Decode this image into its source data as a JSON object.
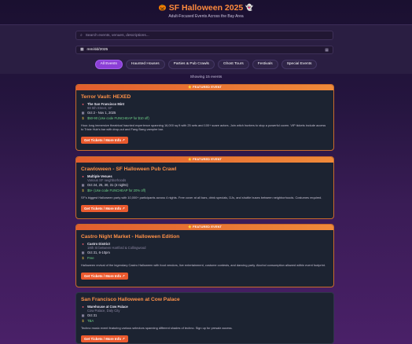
{
  "header": {
    "title": "SF Halloween 2025",
    "title_emoji_left": "🎃",
    "title_emoji_right": "👻",
    "subtitle": "Adult-Focused Events Across the Bay Area"
  },
  "search": {
    "placeholder": "Search events, venues, descriptions..."
  },
  "date_filter": {
    "value": "mm/dd/2025"
  },
  "tabs": [
    {
      "label": "All Events",
      "active": true
    },
    {
      "label": "Haunted Houses",
      "active": false
    },
    {
      "label": "Parties & Pub Crawls",
      "active": false
    },
    {
      "label": "Ghost Tours",
      "active": false
    },
    {
      "label": "Festivals",
      "active": false
    },
    {
      "label": "Special Events",
      "active": false
    }
  ],
  "count_text": "Showing 15 events",
  "featured_label": "⭐ FEATURED EVENT",
  "events": [
    {
      "featured": true,
      "title": "Terror Vault: HEXED",
      "venue": "The San Francisco Mint",
      "address": "88 5th Street, SF",
      "dates": "Oct 2 - Nov 1, 2025",
      "price": "$50-90 (Use code FUNCHEAP for $10 off)",
      "description": "Hour-long immersive theatrical haunted experience spanning 16,000 sq ft with 25 sets and 100+ scare actors. Join witch hunters to stop a powerful coven. VIP tickets include access to Trixie Hub's bar with drop-out and Fang Bang vampire bar.",
      "button": "Get Tickets / More Info ↗"
    },
    {
      "featured": true,
      "title": "Crawloween - SF Halloween Pub Crawl",
      "venue": "Multiple Venues",
      "address": "Various SF neighborhoods",
      "dates": "Oct 24, 25, 30, 31 (4 nights)",
      "price": "$5+ (Use code FUNCHEAP for 20% off)",
      "description": "SF's biggest Halloween party with 10,000+ participants across 4 nights. Free cover at all bars, drink specials, DJs, and shuttle buses between neighborhoods. Costumes required.",
      "button": "Get Tickets / More Info ↗"
    },
    {
      "featured": true,
      "title": "Castro Night Market - Halloween Edition",
      "venue": "Castro District",
      "address": "18th St between Hartford & Collingwood",
      "dates": "Oct 31, 6-10pm",
      "price": "Free",
      "description": "Halloween revival of the legendary Castro Halloween with food vendors, live entertainment, costume contests, and dancing party. Alcohol consumption allowed within event footprint.",
      "button": "Get Tickets / More Info ↗"
    },
    {
      "featured": false,
      "title": "San Francisco Halloween at Cow Palace",
      "venue": "Warehouse at Cow Palace",
      "address": "Cow Palace, Daly City",
      "dates": "Oct 31",
      "price": "TBA",
      "description": "Techno music event featuring various selectors spanning different shades of techno. Sign up for presale access.",
      "button": "Get Tickets / More Info ↗"
    }
  ]
}
